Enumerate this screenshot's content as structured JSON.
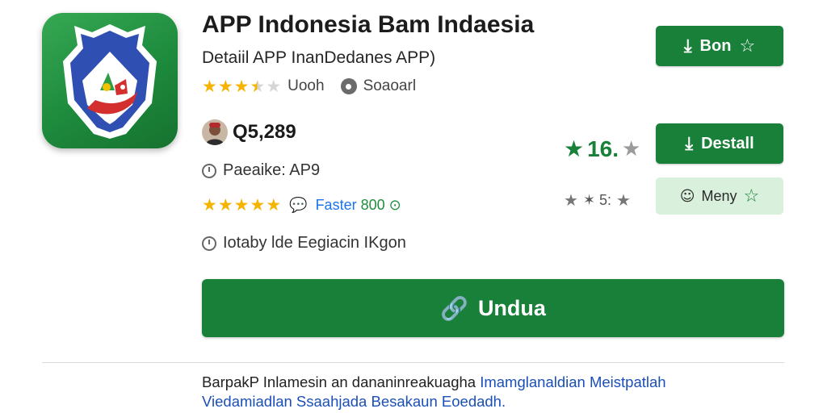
{
  "app": {
    "title": "APP Indonesia Bam Indaesia",
    "subtitle": "Detaiil APP InanDedanes APP)",
    "rating_stars": 3.5,
    "rating_label": "Uooh",
    "category": "Soaoarl",
    "downloads": "Q5,289",
    "package": "Paeaike: AP9",
    "review_stars": 5,
    "faster_label": "Faster",
    "faster_count": "800",
    "age_label": "Iotaby lde Eegiacin IKgon"
  },
  "side": {
    "big_rating": "16.",
    "small_rating": "✶ 5:",
    "bon_button": "Bon",
    "install_button": "Destall",
    "light_button": "Meny"
  },
  "download_button": "Undua",
  "description": {
    "line1_text": "BarpakP Inlamesin an dananinreakuagha ",
    "line1_link": "Imamglanaldian Meistpatlah",
    "line2_link": "Viedamiadlan Ssaahjada Besakaun Eoedadh."
  },
  "icons": {
    "app": "shield-logo-icon",
    "download": "download-icon",
    "star": "star-icon",
    "chat": "chat-bubble-icon",
    "clock": "clock-icon",
    "link": "link-icon"
  },
  "colors": {
    "accent": "#188038",
    "star": "#f4b400",
    "link": "#1a73e8",
    "light_button": "#d8f0dc"
  }
}
